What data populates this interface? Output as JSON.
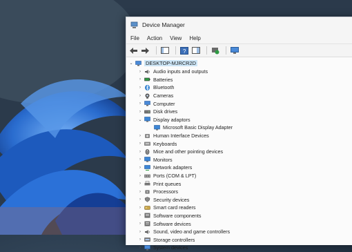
{
  "window": {
    "title": "Device Manager",
    "menu": [
      "File",
      "Action",
      "View",
      "Help"
    ]
  },
  "tree": {
    "root": "DESKTOP-MJRCR2D",
    "items": [
      {
        "label": "Audio inputs and outputs",
        "icon": "speaker-icon",
        "expanded": false
      },
      {
        "label": "Batteries",
        "icon": "battery-icon",
        "expanded": false
      },
      {
        "label": "Bluetooth",
        "icon": "bluetooth-icon",
        "expanded": false
      },
      {
        "label": "Cameras",
        "icon": "camera-icon",
        "expanded": false
      },
      {
        "label": "Computer",
        "icon": "computer-icon",
        "expanded": false
      },
      {
        "label": "Disk drives",
        "icon": "disk-icon",
        "expanded": false
      },
      {
        "label": "Display adaptors",
        "icon": "monitor-icon",
        "expanded": true
      },
      {
        "label": "Microsoft Basic Display Adapter",
        "icon": "monitor-icon",
        "child": true
      },
      {
        "label": "Human Interface Devices",
        "icon": "hid-icon",
        "expanded": false
      },
      {
        "label": "Keyboards",
        "icon": "keyboard-icon",
        "expanded": false
      },
      {
        "label": "Mice and other pointing devices",
        "icon": "mouse-icon",
        "expanded": false
      },
      {
        "label": "Monitors",
        "icon": "monitor-icon",
        "expanded": false
      },
      {
        "label": "Network adapters",
        "icon": "network-icon",
        "expanded": false
      },
      {
        "label": "Ports (COM & LPT)",
        "icon": "port-icon",
        "expanded": false
      },
      {
        "label": "Print queues",
        "icon": "printer-icon",
        "expanded": false
      },
      {
        "label": "Processors",
        "icon": "processor-icon",
        "expanded": false
      },
      {
        "label": "Security devices",
        "icon": "security-icon",
        "expanded": false
      },
      {
        "label": "Smart card readers",
        "icon": "smartcard-icon",
        "expanded": false
      },
      {
        "label": "Software components",
        "icon": "software-icon",
        "expanded": false
      },
      {
        "label": "Software devices",
        "icon": "software-icon",
        "expanded": false
      },
      {
        "label": "Sound, video and game controllers",
        "icon": "speaker-icon",
        "expanded": false
      },
      {
        "label": "Storage controllers",
        "icon": "storage-icon",
        "expanded": false
      },
      {
        "label": "System devices",
        "icon": "computer-icon",
        "expanded": false
      }
    ]
  },
  "colors": {
    "selection": "#cde6f7",
    "icon_blue": "#2f7fd0",
    "wallpaper_blue": "#1f5fc6"
  }
}
